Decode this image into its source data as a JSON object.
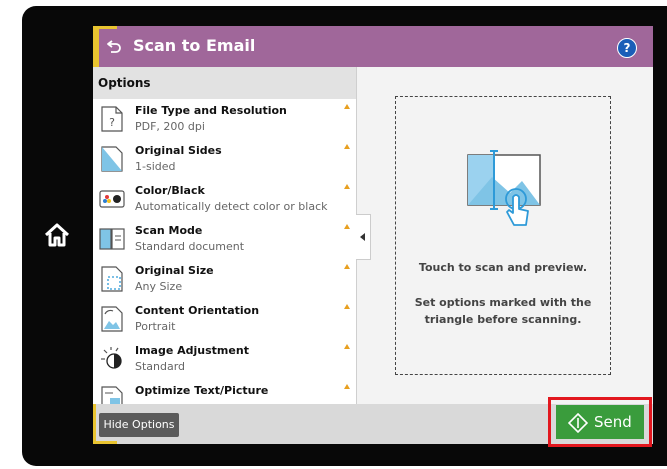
{
  "header": {
    "title": "Scan to Email",
    "help_label": "?"
  },
  "options": {
    "heading": "Options",
    "items": [
      {
        "title": "File Type and Resolution",
        "value": "PDF, 200 dpi",
        "icon": "file-type-icon"
      },
      {
        "title": "Original Sides",
        "value": "1-sided",
        "icon": "original-sides-icon"
      },
      {
        "title": "Color/Black",
        "value": "Automatically detect color or black",
        "icon": "color-black-icon"
      },
      {
        "title": "Scan Mode",
        "value": "Standard document",
        "icon": "scan-mode-icon"
      },
      {
        "title": "Original Size",
        "value": "Any Size",
        "icon": "original-size-icon"
      },
      {
        "title": "Content Orientation",
        "value": "Portrait",
        "icon": "content-orientation-icon"
      },
      {
        "title": "Image Adjustment",
        "value": "Standard",
        "icon": "image-adjustment-icon"
      },
      {
        "title": "Optimize Text/Picture",
        "value": "",
        "icon": "optimize-text-picture-icon"
      }
    ]
  },
  "preview": {
    "line1": "Touch to scan and preview.",
    "line2": "Set options marked with the triangle before scanning."
  },
  "footer": {
    "hide_options": "Hide Options",
    "send": "Send"
  },
  "colors": {
    "header": "#a0679a",
    "accent": "#e9c430",
    "send": "#3a9c3c",
    "highlight": "#e2171e",
    "help": "#1a5eb8"
  }
}
